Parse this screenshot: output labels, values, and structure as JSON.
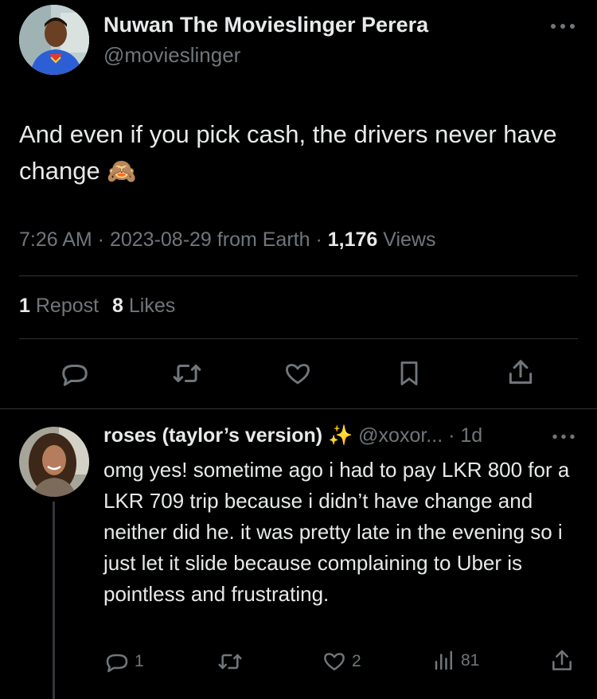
{
  "tweet": {
    "author_name": "Nuwan The Movieslinger Perera",
    "author_handle": "@movieslinger",
    "text": "And even if you pick cash, the drivers never have change",
    "emoji": "🙈",
    "time": "7:26 AM",
    "date": "2023-08-29",
    "source": "from Earth",
    "views_count": "1,176",
    "views_label": "Views",
    "reposts_count": "1",
    "reposts_label": "Repost",
    "likes_count": "8",
    "likes_label": "Likes"
  },
  "reply": {
    "author_name": "roses (taylor’s version)",
    "author_emoji": "✨",
    "author_handle": "@xoxor...",
    "age": "1d",
    "text": "omg yes! sometime ago i had to pay LKR 800 for a LKR 709 trip because i didn’t have change and neither did he. it was pretty late in the evening so i just let it slide because complaining to Uber is pointless and frustrating.",
    "reply_count": "1",
    "like_count": "2",
    "view_count": "81"
  },
  "icons": {
    "more": "more-icon",
    "reply": "reply-icon",
    "retweet": "retweet-icon",
    "like": "heart-icon",
    "bookmark": "bookmark-icon",
    "share": "share-icon",
    "views": "analytics-icon"
  },
  "colors": {
    "background": "#000000",
    "text": "#e7e9ea",
    "muted": "#71767b",
    "divider": "#2f3336"
  }
}
